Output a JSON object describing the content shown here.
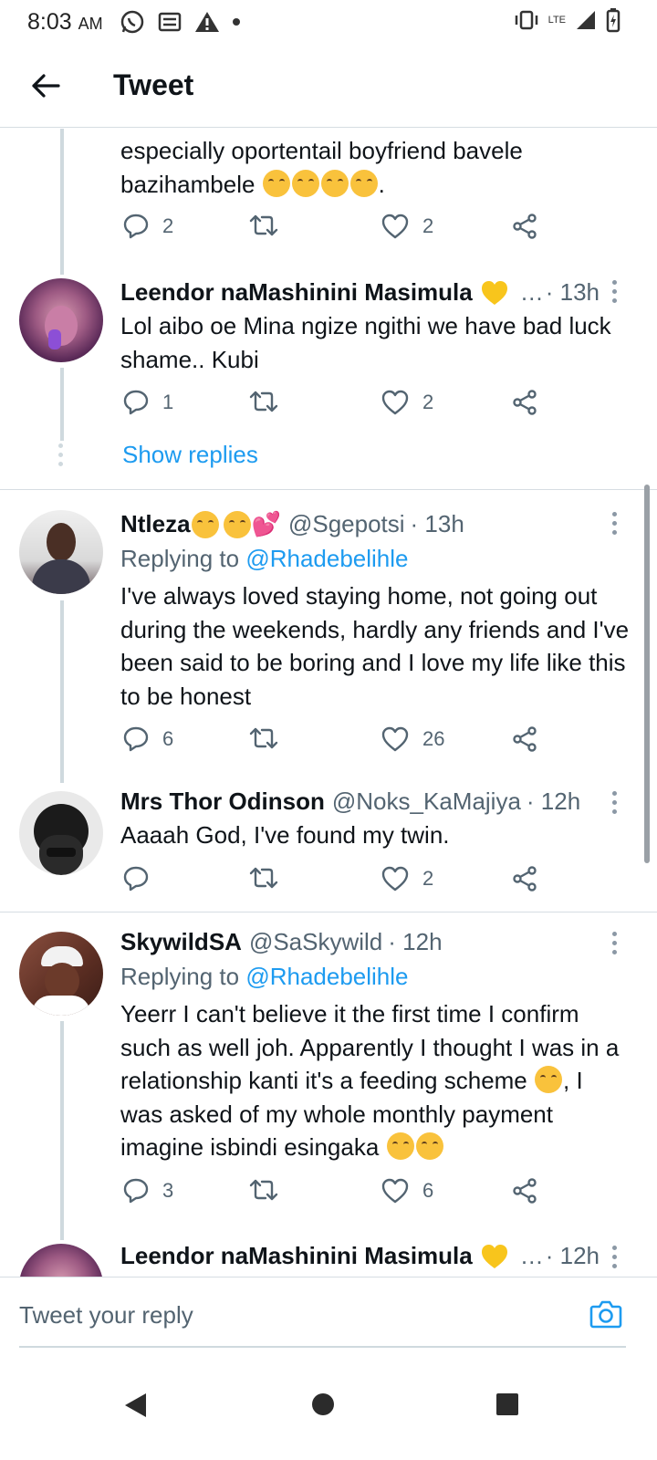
{
  "status_bar": {
    "time": "8:03",
    "ampm": "AM",
    "network": "LTE"
  },
  "header": {
    "title": "Tweet"
  },
  "tweets": [
    {
      "text_lines": [
        "especially oportentail boyfriend bavele",
        "bazihambele"
      ],
      "trailing": ".",
      "replies": "2",
      "retweets": "",
      "likes": "2"
    },
    {
      "name": "Leendor naMashinini Masimula",
      "handle": "…",
      "time": "· 13h",
      "text": "Lol aibo oe Mina ngize ngithi we have bad luck shame.. Kubi",
      "replies": "1",
      "likes": "2",
      "show_replies": "Show replies"
    },
    {
      "name": "Ntleza",
      "handle": "@Sgepotsi",
      "time": "· 13h",
      "replying_prefix": "Replying to",
      "replying_to": "@Rhadebelihle",
      "text": "I've always loved staying home, not going out during the weekends, hardly any friends and I've been said to be boring and I love my life like this to be honest",
      "replies": "6",
      "likes": "26"
    },
    {
      "name": "Mrs Thor Odinson",
      "handle": "@Noks_KaMajiya",
      "time": "· 12h",
      "text": "Aaaah God, I've found my twin.",
      "replies": "",
      "likes": "2"
    },
    {
      "name": "SkywildSA",
      "handle": "@SaSkywild",
      "time": "· 12h",
      "replying_prefix": "Replying to",
      "replying_to": "@Rhadebelihle",
      "text_a": "Yeerr I can't believe it the first time I confirm such as well joh. Apparently I thought I was in a relationship kanti it's a feeding scheme",
      "text_b": ", I was asked of my whole monthly payment imagine isbindi esingaka",
      "replies": "3",
      "likes": "6"
    },
    {
      "name": "Leendor naMashinini Masimula",
      "handle": "…",
      "time": "· 12h"
    }
  ],
  "reply_bar": {
    "placeholder": "Tweet your reply"
  },
  "colors": {
    "accent": "#1d9bf0",
    "muted": "#536471",
    "divider": "#d6dde2"
  },
  "icons": [
    "back-arrow-icon",
    "reply-icon",
    "retweet-icon",
    "like-icon",
    "share-icon",
    "more-icon",
    "camera-icon",
    "nav-back-icon",
    "nav-home-icon",
    "nav-recents-icon"
  ]
}
